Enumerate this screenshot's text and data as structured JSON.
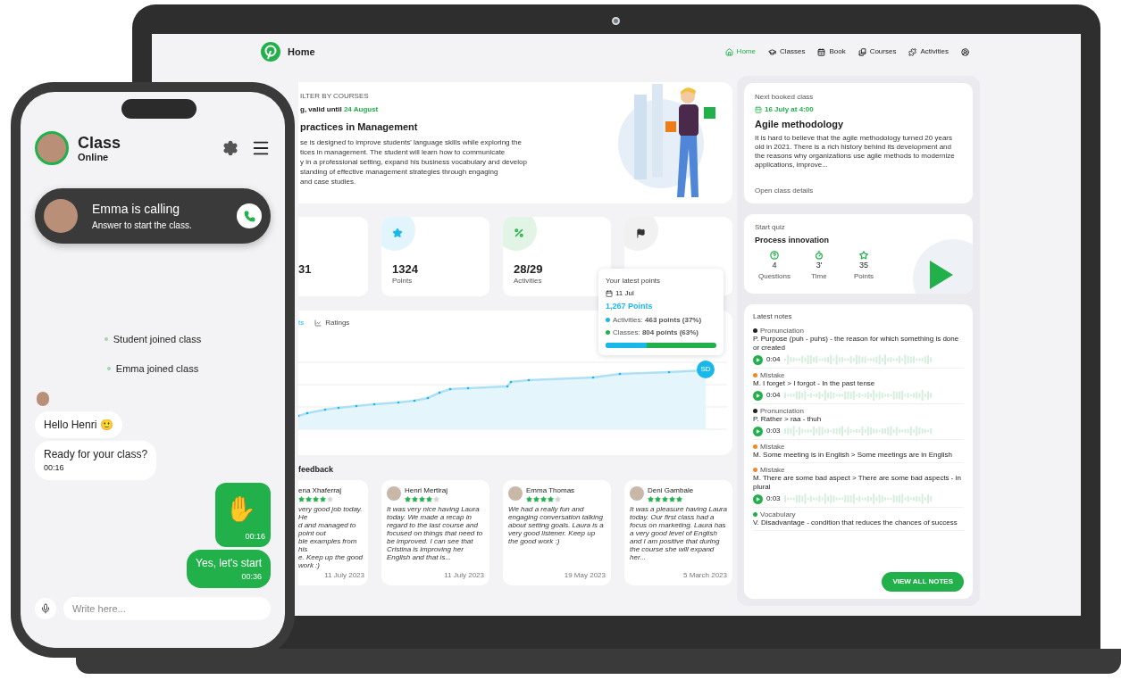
{
  "laptop": {
    "header": {
      "title": "Home",
      "nav": [
        {
          "label": "Home",
          "kind": "home",
          "selected": true
        },
        {
          "label": "Classes",
          "kind": "cap",
          "selected": false
        },
        {
          "label": "Book",
          "kind": "calendar",
          "selected": false
        },
        {
          "label": "Courses",
          "kind": "books",
          "selected": false
        },
        {
          "label": "Activities",
          "kind": "puzzle",
          "selected": false
        },
        {
          "kind": "user",
          "selected": false
        }
      ]
    },
    "course_card": {
      "filter_label": "ILTER BY COURSES",
      "validity_prefix": "g, valid until",
      "validity_date": "24 August",
      "title": "practices in Management",
      "description_lines": [
        "se is designed to improve students' language skills while exploring the",
        "tices in management. The student will learn how to communicate",
        "y in a professional setting, expand his business vocabulary and develop",
        "standing of effective management strategies through engaging",
        "and case studies."
      ]
    },
    "stats": [
      {
        "kind": "plain",
        "value": "31"
      },
      {
        "kind": "star",
        "value": "1324",
        "label": "Points"
      },
      {
        "kind": "percent",
        "value": "28/29",
        "label": "Activities"
      },
      {
        "kind": "flag"
      }
    ],
    "chart": {
      "tabs": [
        {
          "label": "ts",
          "kind": "plain",
          "selected": true
        },
        {
          "label": "Ratings",
          "kind": "chart",
          "selected": false
        }
      ],
      "end_badge": "SD",
      "tooltip": {
        "title": "Your latest points",
        "date": "11 Jul",
        "total": "1,267 Points",
        "parts": [
          {
            "color": "#1ab8ea",
            "text": "Activities: **463 points (37%)**"
          },
          {
            "color": "#22b04b",
            "text": "Classes: **804 points (63%)**"
          }
        ],
        "level": 0.37
      }
    },
    "feedback": {
      "title": "feedback",
      "cards": [
        {
          "name": "ena Xhaferraj",
          "stars": 4,
          "text_lines": [
            "very good job today. He",
            "d and managed to point out",
            "ble examples from his",
            "e. Keep up the good work :)"
          ],
          "date": "11 July 2023"
        },
        {
          "name": "Henri Mertiraj",
          "stars": 4,
          "text": "It was very nice having Laura today. We made a recap in regard to the last course and focused on things that need to be improved. I can see that Cristina is improving her English and that is...",
          "date": "11 July 2023"
        },
        {
          "name": "Emma Thomas",
          "stars": 4,
          "text": "We had a really fun and engaging conversation talking about setting goals. Laura is a very good listener. Keep up the good work :)",
          "date": "19 May 2023"
        },
        {
          "name": "Deni Gambale",
          "stars": 5,
          "text": "It was a pleasure having Laura today. Our first class had a focus on marketing. Laura has a very good level of English and I am positive that during the course she will expand her...",
          "date": "5 March 2023"
        }
      ]
    },
    "next_class": {
      "label": "Next booked class",
      "date": "16 July at 4:00",
      "title": "Agile methodology",
      "text": "It is hard to believe that the agile methodology turned 20 years old in 2021. There is a rich history behind its development and the reasons why organizations use agile methods to modernize applications, improve...",
      "link": "Open class details"
    },
    "quiz": {
      "label": "Start quiz",
      "title": "Process innovation",
      "stats": [
        {
          "kind": "question",
          "value": "4",
          "label": "Questions"
        },
        {
          "kind": "timer",
          "value": "3'",
          "label": "Time"
        },
        {
          "kind": "star",
          "value": "35",
          "label": "Points"
        }
      ]
    },
    "notes": {
      "title": "Latest notes",
      "items": [
        {
          "category": "Pronunciation",
          "color": "#222222",
          "text": "P. Purpose (puh - puhs) - the reason for which something is done or created",
          "audio": "0:04"
        },
        {
          "category": "Mistake",
          "color": "#f08a24",
          "text": "M. I forget > I forgot - In the past tense",
          "audio": "0:04"
        },
        {
          "category": "Pronunciation",
          "color": "#222222",
          "text": "P. Rather > raa - thuh",
          "audio": "0:03"
        },
        {
          "category": "Mistake",
          "color": "#f08a24",
          "text": "M. Some meeting is in English > Some meetings are in English"
        },
        {
          "category": "Mistake",
          "color": "#f08a24",
          "text": "M. There are some bad aspect > There are some bad aspects - in plural",
          "audio": "0:03"
        },
        {
          "category": "Vocabulary",
          "color": "#22b04b",
          "text": "V. Disadvantage - condition that reduces the chances of success"
        }
      ],
      "button": "VIEW ALL NOTES"
    }
  },
  "phone": {
    "title": "Class",
    "status": "Online",
    "call": {
      "title": "Emma is calling",
      "subtitle": "Answer to start the class."
    },
    "events": [
      "Student joined class",
      "Emma joined class"
    ],
    "messages": [
      {
        "kind": "incoming",
        "text": "Hello Henri 🙂",
        "avatar": true
      },
      {
        "kind": "incoming",
        "text": "Ready for your class?",
        "time": "00:16"
      },
      {
        "kind": "outgoing_emoji",
        "text": "✋",
        "time": "00:16"
      },
      {
        "kind": "outgoing",
        "text": "Yes, let's start",
        "time": "00:36"
      }
    ],
    "input": {
      "placeholder": "Write here..."
    }
  }
}
